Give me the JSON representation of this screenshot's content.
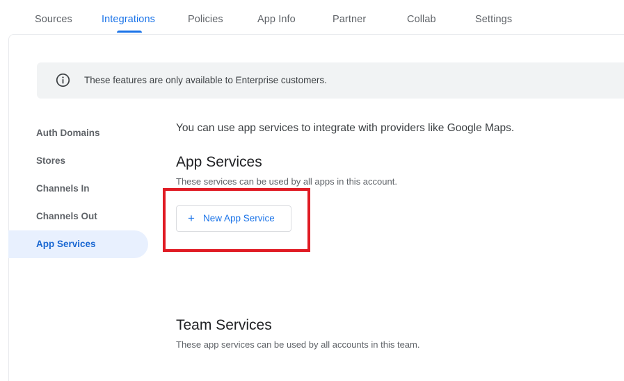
{
  "tabs": [
    {
      "label": "Sources",
      "active": false
    },
    {
      "label": "Integrations",
      "active": true
    },
    {
      "label": "Policies",
      "active": false
    },
    {
      "label": "App Info",
      "active": false
    },
    {
      "label": "Partner",
      "active": false
    },
    {
      "label": "Collab",
      "active": false
    },
    {
      "label": "Settings",
      "active": false
    }
  ],
  "banner": {
    "icon": "info-icon",
    "text": "These features are only available to Enterprise customers."
  },
  "sidebar": {
    "items": [
      {
        "label": "Auth Domains",
        "active": false
      },
      {
        "label": "Stores",
        "active": false
      },
      {
        "label": "Channels In",
        "active": false
      },
      {
        "label": "Channels Out",
        "active": false
      },
      {
        "label": "App Services",
        "active": true
      }
    ]
  },
  "main": {
    "intro": "You can use app services to integrate with providers like Google Maps.",
    "app_services": {
      "title": "App Services",
      "subtitle": "These services can be used by all apps in this account.",
      "new_button_label": "New App Service",
      "new_button_icon": "plus-icon"
    },
    "team_services": {
      "title": "Team Services",
      "subtitle": "These app services can be used by all accounts in this team."
    }
  },
  "colors": {
    "accent": "#1a73e8",
    "highlight": "#e01b24",
    "active_nav_bg": "#e8f0fe"
  }
}
